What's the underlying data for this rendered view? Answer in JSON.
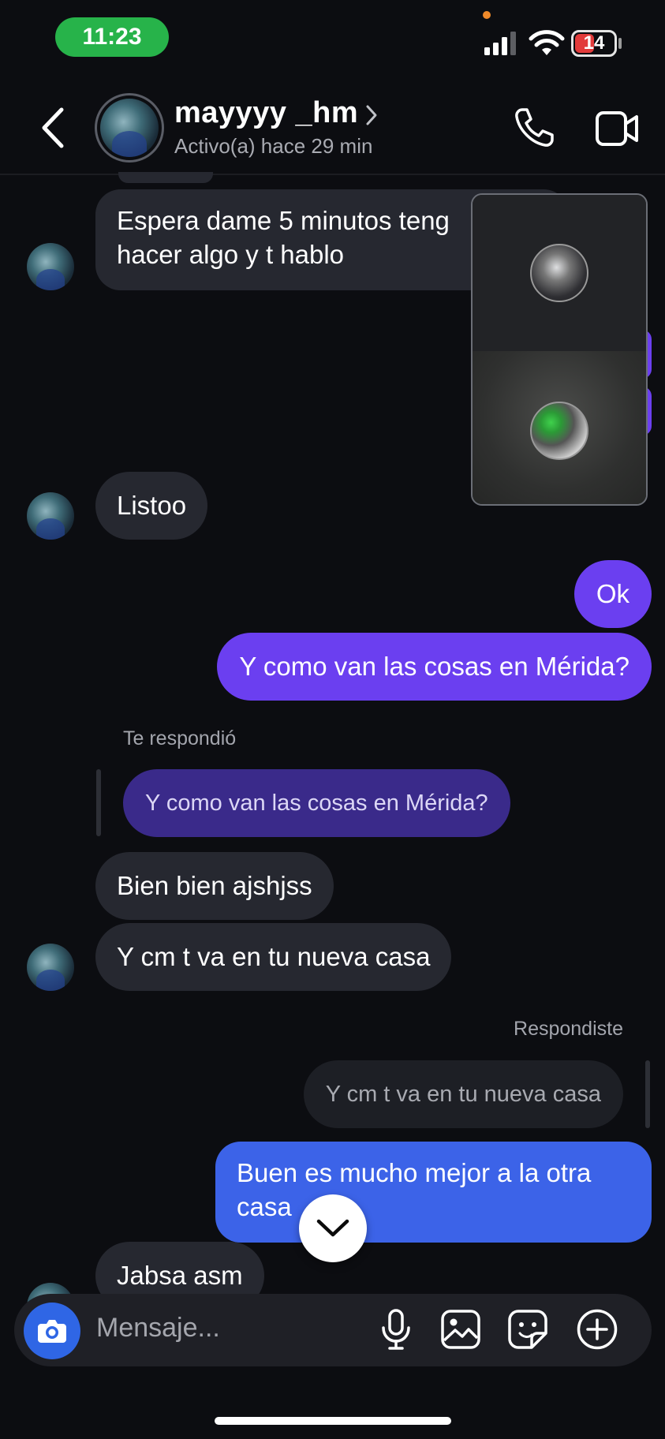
{
  "status_bar": {
    "time": "11:23",
    "battery": "14"
  },
  "header": {
    "contact_name": "mayyyy _hm",
    "status": "Activo(a) hace 29 min"
  },
  "messages": [
    {
      "id": "m1",
      "direction": "incoming",
      "lines": [
        "Espera dame 5 minutos teng",
        "hacer algo y t hablo"
      ]
    },
    {
      "id": "m2",
      "direction": "incoming",
      "text": "Listoo"
    },
    {
      "id": "m3",
      "direction": "outgoing",
      "text": "Ok"
    },
    {
      "id": "m4",
      "direction": "outgoing",
      "text": "Y como van las cosas en Mérida?"
    },
    {
      "id": "m5",
      "direction": "incoming",
      "reply_label": "Te respondió",
      "quoted": "Y como van las cosas en Mérida?",
      "text": "Bien bien ajshjss"
    },
    {
      "id": "m6",
      "direction": "incoming",
      "text": "Y cm t va en tu nueva casa"
    },
    {
      "id": "m7",
      "direction": "outgoing",
      "reply_label": "Respondiste",
      "quoted": "Y cm t va en tu nueva casa",
      "lines": [
        "Buen es mucho mejor a la otra",
        "casa"
      ]
    },
    {
      "id": "m8",
      "direction": "incoming",
      "text": "Jabsa asm"
    }
  ],
  "composer": {
    "placeholder": "Mensaje..."
  },
  "colors": {
    "background": "#0c0d11",
    "incoming_bubble": "#262830",
    "outgoing_purple": "#6b3ff0",
    "outgoing_blue": "#3c63e8",
    "quoted_outgoing": "#3a2a8a",
    "camera_button": "#2f66e5"
  },
  "icons": {
    "back": "chevron-left-icon",
    "call": "phone-icon",
    "video": "video-camera-icon",
    "camera": "camera-icon",
    "mic": "microphone-icon",
    "gallery": "image-icon",
    "sticker": "sticker-icon",
    "plus": "plus-circle-icon",
    "scroll_down": "chevron-down-icon"
  }
}
